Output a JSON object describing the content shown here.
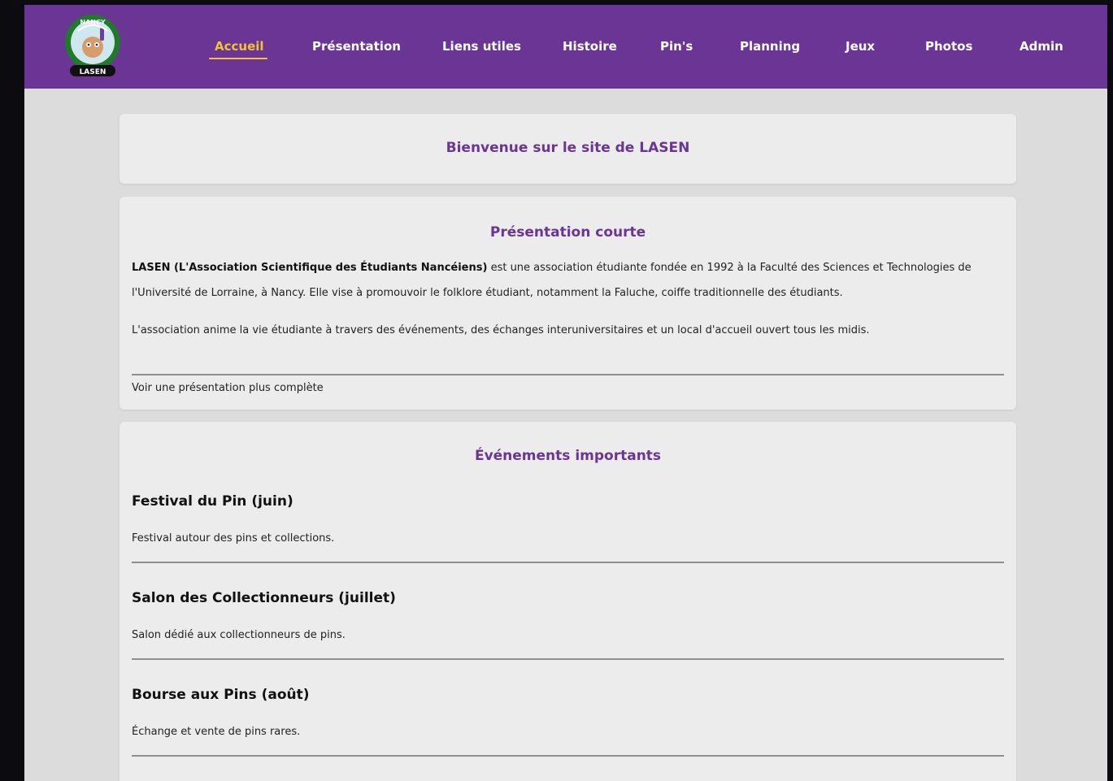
{
  "nav": {
    "items": [
      {
        "label": "Accueil",
        "active": true
      },
      {
        "label": "Présentation"
      },
      {
        "label": "Liens utiles"
      },
      {
        "label": "Histoire"
      },
      {
        "label": "Pin's"
      },
      {
        "label": "Planning"
      },
      {
        "label": "Jeux"
      },
      {
        "label": "Photos"
      },
      {
        "label": "Admin"
      }
    ],
    "logo": {
      "top_text": "NANCY",
      "bottom_text": "LASEN"
    }
  },
  "welcome": {
    "title": "Bienvenue sur le site de LASEN"
  },
  "presentation": {
    "title": "Présentation courte",
    "bold_lead": "LASEN (L'Association Scientifique des Étudiants Nancéiens)",
    "paragraph1_rest": " est une association étudiante fondée en 1992 à la Faculté des Sciences et Technologies de l'Université de Lorraine, à Nancy. Elle vise à promouvoir le folklore étudiant, notamment la Faluche, coiffe traditionnelle des étudiants.",
    "paragraph2": "L'association anime la vie étudiante à travers des événements, des échanges interuniversitaires et un local d'accueil ouvert tous les midis.",
    "more_link": "Voir une présentation plus complète"
  },
  "events": {
    "title": "Événements importants",
    "items": [
      {
        "title": "Festival du Pin (juin)",
        "desc": "Festival autour des pins et collections."
      },
      {
        "title": "Salon des Collectionneurs (juillet)",
        "desc": "Salon dédié aux collectionneurs de pins."
      },
      {
        "title": "Bourse aux Pins (août)",
        "desc": "Échange et vente de pins rares."
      }
    ]
  },
  "colors": {
    "brand_purple": "#6a3595",
    "active_yellow": "#f3c431",
    "page_bg": "#dcdcdc",
    "card_bg": "#ececec"
  }
}
